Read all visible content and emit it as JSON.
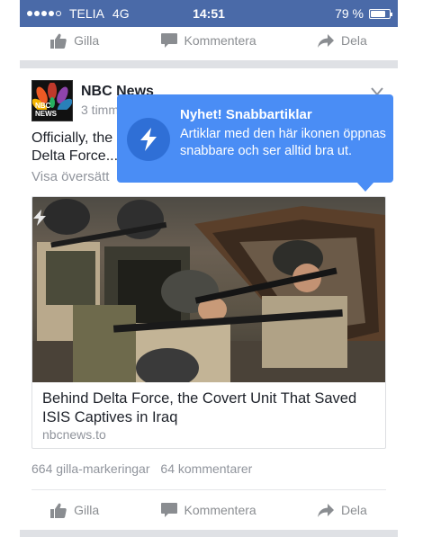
{
  "status_bar": {
    "carrier": "TELIA",
    "network": "4G",
    "time": "14:51",
    "battery": "79 %",
    "battery_level": 0.79,
    "signal_bars_filled": 4,
    "signal_bars_total": 5
  },
  "top_actions": {
    "like": "Gilla",
    "comment": "Kommentera",
    "share": "Dela"
  },
  "post": {
    "page_name": "NBC News",
    "time": "3 timm",
    "avatar_text": "NBC NEWS",
    "text_line1": "Officially, the",
    "text_line2": "Delta Force...",
    "translate": "Visa översätt",
    "menu_icon": "chevron-down-icon"
  },
  "tooltip": {
    "title": "Nyhet! Snabbartiklar",
    "body": "Artiklar med den här ikonen öppnas snabbare och ser alltid bra ut."
  },
  "card": {
    "title": "Behind Delta Force, the Covert Unit That Saved ISIS Captives in Iraq",
    "domain": "nbcnews.to"
  },
  "stats": {
    "likes": "664 gilla-markeringar",
    "comments": "64 kommentarer"
  },
  "bottom_actions": {
    "like": "Gilla",
    "comment": "Kommentera",
    "share": "Dela"
  },
  "colors": {
    "status_bar": "#4a6aa8",
    "tooltip": "#4a8df5",
    "action_text": "#8a8d91"
  }
}
